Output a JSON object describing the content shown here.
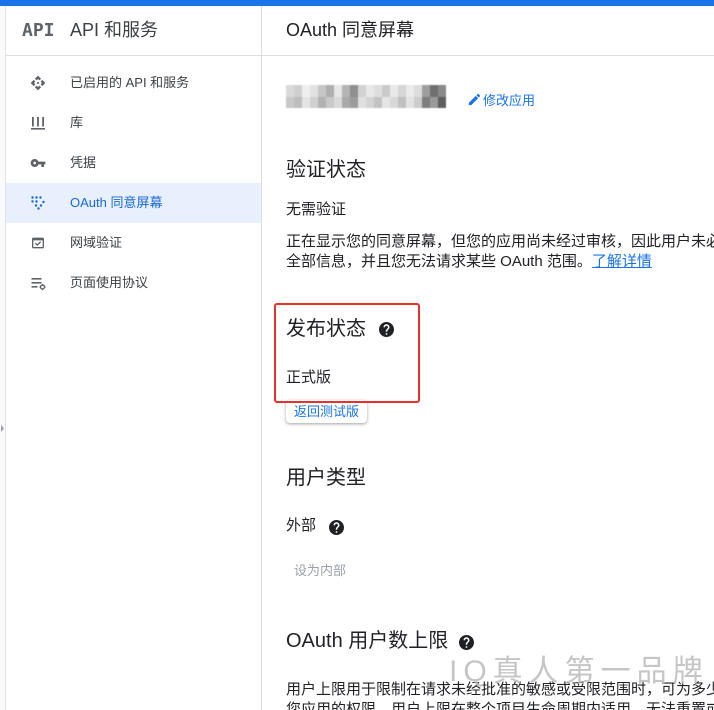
{
  "sidebar": {
    "logo_text": "API",
    "title": "API 和服务",
    "items": [
      {
        "label": "已启用的 API 和服务",
        "icon": "api-icon"
      },
      {
        "label": "库",
        "icon": "library-icon"
      },
      {
        "label": "凭据",
        "icon": "key-icon"
      },
      {
        "label": "OAuth 同意屏幕",
        "icon": "consent-screen-icon",
        "selected": true
      },
      {
        "label": "网域验证",
        "icon": "domain-verification-icon"
      },
      {
        "label": "页面使用协议",
        "icon": "page-usage-agreements-icon"
      }
    ]
  },
  "main": {
    "title": "OAuth 同意屏幕",
    "edit_app_label": "修改应用",
    "verification": {
      "heading": "验证状态",
      "status": "无需验证",
      "description_lines": [
        "正在显示您的同意屏幕，但您的应用尚未经过审核，因此用户未必",
        "全部信息，并且您无法请求某些 OAuth 范围。"
      ],
      "learn_more_label": "了解详情"
    },
    "publishing": {
      "heading": "发布状态",
      "status": "正式版",
      "back_to_testing_label": "返回测试版"
    },
    "user_type": {
      "heading": "用户类型",
      "value": "外部",
      "make_internal_label": "设为内部"
    },
    "user_cap": {
      "heading": "OAuth 用户数上限",
      "description_lines": [
        "用户上限用于限制在请求未经批准的敏感或受限范围时，可为多少",
        "您应用的权限。用户上限在整个项目生命周期内适用，无法重置或"
      ]
    }
  },
  "watermark": "IQ真人第一品牌",
  "colors": {
    "top_bar": "#1a73e8",
    "accent": "#1a73e8",
    "selected_background": "#e8f0fe",
    "selected_text": "#1967d2",
    "annotation_red": "#e5322d",
    "text": "#202124",
    "muted_icon": "#5f6368",
    "disabled_text": "#9aa0a6"
  }
}
